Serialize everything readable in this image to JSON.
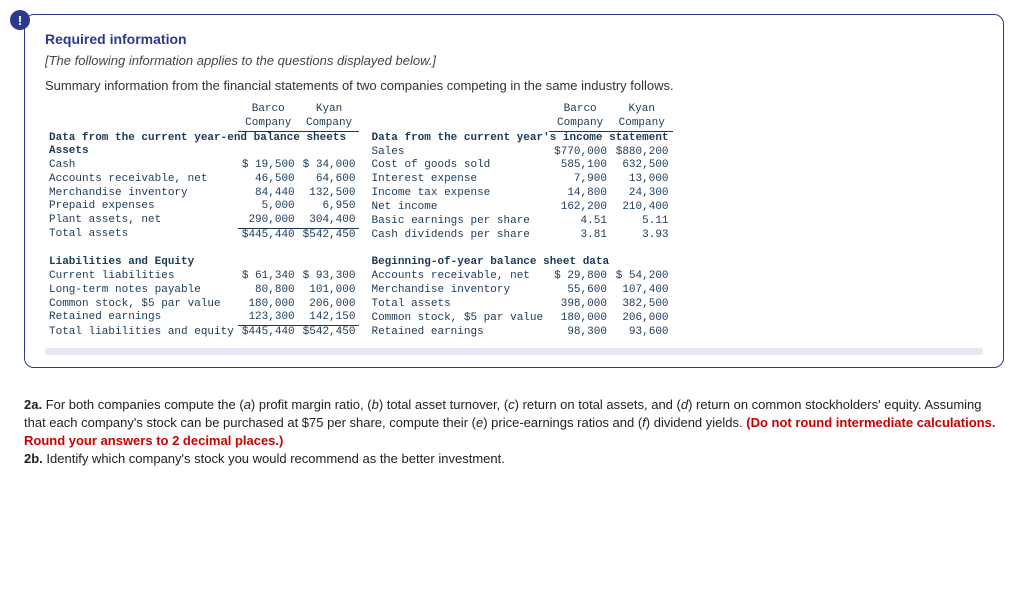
{
  "info_icon": "!",
  "required_label": "Required information",
  "applies_text": "[The following information applies to the questions displayed below.]",
  "summary_text": "Summary information from the financial statements of two companies competing in the same industry follows.",
  "col_barco": "Barco",
  "col_company": "Company",
  "col_kyan": "Kyan",
  "left": {
    "hdr_balance": "Data from the current year-end balance sheets",
    "assets": "Assets",
    "cash": "Cash",
    "cash_b": "$ 19,500",
    "cash_k": "$ 34,000",
    "ar": "Accounts receivable, net",
    "ar_b": "46,500",
    "ar_k": "64,600",
    "mi": "Merchandise inventory",
    "mi_b": "84,440",
    "mi_k": "132,500",
    "pe": "Prepaid expenses",
    "pe_b": "5,000",
    "pe_k": "6,950",
    "pa": "Plant assets, net",
    "pa_b": "290,000",
    "pa_k": "304,400",
    "ta": "Total assets",
    "ta_b": "$445,440",
    "ta_k": "$542,450",
    "liab": "Liabilities and Equity",
    "cl": "Current liabilities",
    "cl_b": "$ 61,340",
    "cl_k": "$ 93,300",
    "ltn": "Long-term notes payable",
    "ltn_b": "80,800",
    "ltn_k": "101,000",
    "cs": "Common stock, $5 par value",
    "cs_b": "180,000",
    "cs_k": "206,000",
    "re": "Retained earnings",
    "re_b": "123,300",
    "re_k": "142,150",
    "tle": "Total liabilities and equity",
    "tle_b": "$445,440",
    "tle_k": "$542,450"
  },
  "right": {
    "hdr_income": "Data from the current year's income statement",
    "sales": "Sales",
    "sales_b": "$770,000",
    "sales_k": "$880,200",
    "cogs": "Cost of goods sold",
    "cogs_b": "585,100",
    "cogs_k": "632,500",
    "ie": "Interest expense",
    "ie_b": "7,900",
    "ie_k": "13,000",
    "ite": "Income tax expense",
    "ite_b": "14,800",
    "ite_k": "24,300",
    "ni": "Net income",
    "ni_b": "162,200",
    "ni_k": "210,400",
    "beps": "Basic earnings per share",
    "beps_b": "4.51",
    "beps_k": "5.11",
    "cdps": "Cash dividends per share",
    "cdps_b": "3.81",
    "cdps_k": "3.93",
    "boy": "Beginning-of-year balance sheet data",
    "arn": "Accounts receivable, net",
    "arn_b": "$ 29,800",
    "arn_k": "$ 54,200",
    "mi2": "Merchandise inventory",
    "mi2_b": "55,600",
    "mi2_k": "107,400",
    "ta2": "Total assets",
    "ta2_b": "398,000",
    "ta2_k": "382,500",
    "cs2": "Common stock, $5 par value",
    "cs2_b": "180,000",
    "cs2_k": "206,000",
    "re2": "Retained earnings",
    "re2_b": "98,300",
    "re2_k": "93,600"
  },
  "q2a_label": "2a.",
  "q2a_text_1": " For both companies compute the (",
  "q2a_a": "a",
  "q2a_text_2": ") profit margin ratio, (",
  "q2a_b": "b",
  "q2a_text_3": ") total asset turnover, (",
  "q2a_c": "c",
  "q2a_text_4": ") return on total assets, and (",
  "q2a_d": "d",
  "q2a_text_5": ") return on common stockholders' equity. Assuming that each company's stock can be purchased at $75 per share, compute their (",
  "q2a_e": "e",
  "q2a_text_6": ") price-earnings ratios and (",
  "q2a_f": "f",
  "q2a_text_7": ") dividend yields. ",
  "q2a_red": "(Do not round intermediate calculations. Round your answers to 2 decimal places.)",
  "q2b_label": "2b.",
  "q2b_text": " Identify which company's stock you would recommend as the better investment."
}
